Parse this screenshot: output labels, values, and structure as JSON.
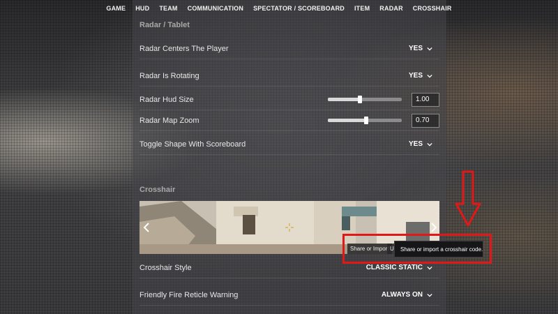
{
  "nav": {
    "tabs": [
      "GAME",
      "HUD",
      "TEAM",
      "COMMUNICATION",
      "SPECTATOR / SCOREBOARD",
      "ITEM",
      "RADAR",
      "CROSSHAIR"
    ]
  },
  "radar": {
    "title": "Radar / Tablet",
    "centers_player": {
      "label": "Radar Centers The Player",
      "value": "YES"
    },
    "rotating": {
      "label": "Radar Is Rotating",
      "value": "YES"
    },
    "hud_size": {
      "label": "Radar Hud Size",
      "value": "1.00",
      "level": 0.43
    },
    "map_zoom": {
      "label": "Radar Map Zoom",
      "value": "0.70",
      "level": 0.52
    },
    "toggle_shape": {
      "label": "Toggle Shape With Scoreboard",
      "value": "YES"
    }
  },
  "crosshair": {
    "title": "Crosshair",
    "share_button": "Share or Import",
    "second_button": "U",
    "tooltip": "Share or import a crosshair code.",
    "style": {
      "label": "Crosshair Style",
      "value": "CLASSIC STATIC"
    },
    "friendly_fire": {
      "label": "Friendly Fire Reticle Warning",
      "value": "ALWAYS ON"
    }
  },
  "colors": {
    "highlight": "#e01818",
    "crosshair_mark": "#d4b25a"
  },
  "icons": {
    "chevron": "chevron-down-icon",
    "prev": "chevron-left-icon",
    "next": "chevron-right-icon",
    "crosshair": "crosshair-icon",
    "annotation": "arrow-down-icon"
  }
}
